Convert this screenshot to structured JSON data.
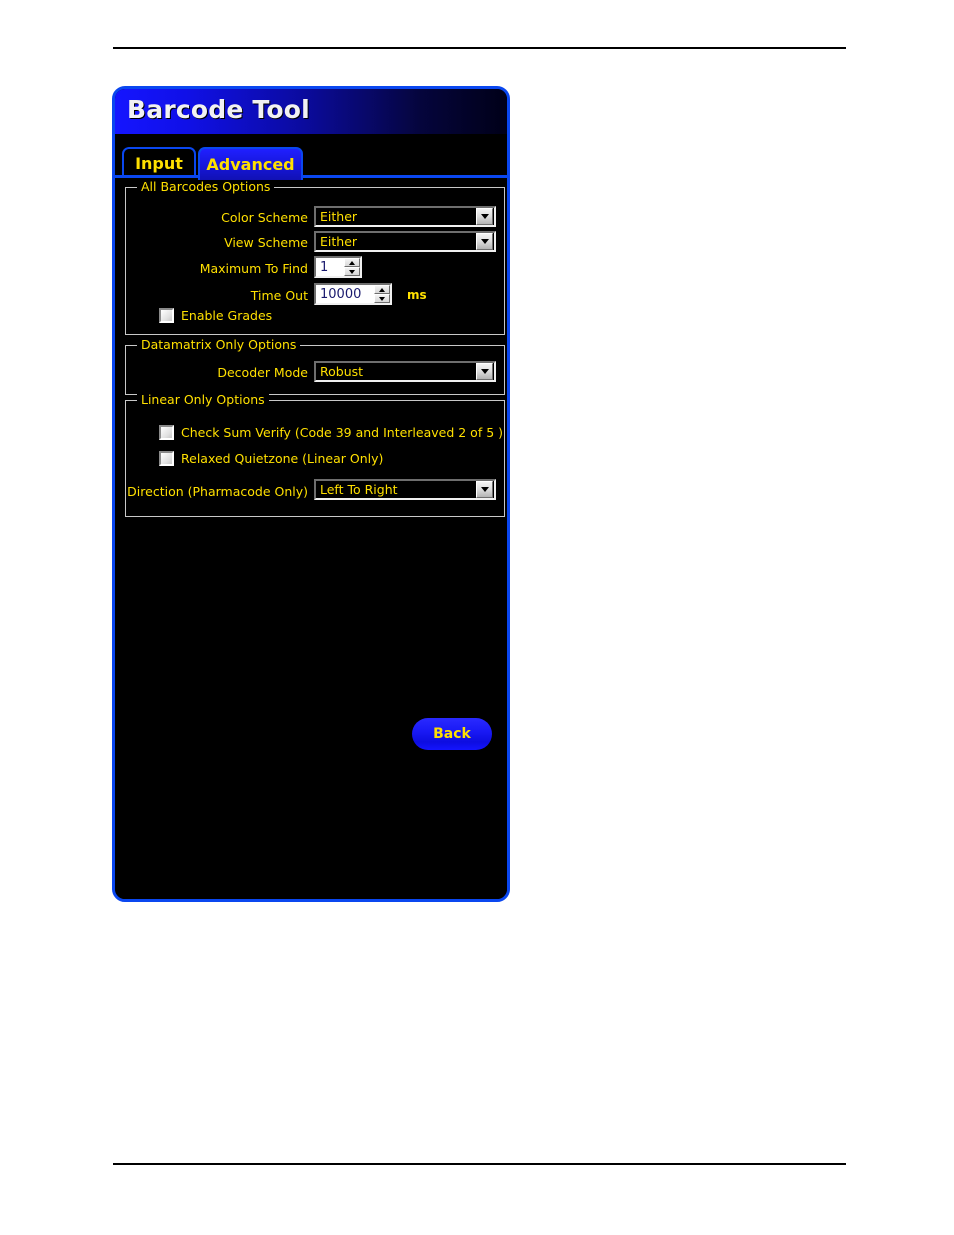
{
  "window": {
    "title": "Barcode Tool"
  },
  "tabs": [
    {
      "label": "Input",
      "active": false
    },
    {
      "label": "Advanced",
      "active": true
    }
  ],
  "groups": {
    "all_barcodes": {
      "legend": "All Barcodes Options",
      "color_scheme": {
        "label": "Color Scheme",
        "value": "Either"
      },
      "view_scheme": {
        "label": "View Scheme",
        "value": "Either"
      },
      "maximum_to_find": {
        "label": "Maximum To Find",
        "value": "1"
      },
      "time_out": {
        "label": "Time Out",
        "value": "10000",
        "unit": "ms"
      },
      "enable_grades": {
        "label": "Enable Grades",
        "checked": false
      }
    },
    "datamatrix": {
      "legend": "Datamatrix Only Options",
      "decoder_mode": {
        "label": "Decoder Mode",
        "value": "Robust"
      }
    },
    "linear": {
      "legend": "Linear Only Options",
      "check_sum_verify": {
        "label": "Check Sum Verify (Code 39 and Interleaved 2 of 5 )",
        "checked": false
      },
      "relaxed_quietzone": {
        "label": "Relaxed Quietzone (Linear Only)",
        "checked": false
      },
      "direction": {
        "label": "Direction (Pharmacode Only)",
        "value": "Left To Right"
      }
    }
  },
  "buttons": {
    "back": "Back"
  },
  "colors": {
    "window_border": "#0a47f0",
    "title_bar_start": "#1515ff",
    "label_yellow": "#ffe000",
    "content_background": "#000000",
    "group_border": "#c8c8c8",
    "spinner_text": "#1a1a6e"
  },
  "icons": {
    "combo_arrow": "chevron-down-icon",
    "spin_up": "spinner-up-icon",
    "spin_down": "spinner-down-icon"
  }
}
